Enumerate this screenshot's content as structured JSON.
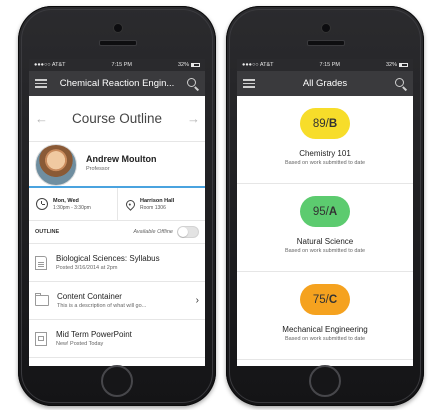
{
  "left_phone": {
    "status": {
      "carrier": "●●●○○ AT&T",
      "time": "7:15 PM",
      "battery": "32%"
    },
    "nav_title": "Chemical Reaction Engin...",
    "outline_title": "Course Outline",
    "prev_arrow": "←",
    "next_arrow": "→",
    "professor": {
      "name": "Andrew Moulton",
      "role": "Professor"
    },
    "schedule": {
      "days": "Mon, Wed",
      "time": "1:30pm - 3:30pm"
    },
    "location": {
      "building": "Harrison Hall",
      "room": "Room 1306"
    },
    "outline_label": "OUTLINE",
    "offline": {
      "label": "Available Offline",
      "enabled": false
    },
    "items": [
      {
        "icon": "pdf-document-icon",
        "title": "Biological Sciences: Syllabus",
        "subtitle": "Posted 3/16/2014 at 2pm"
      },
      {
        "icon": "folder-icon",
        "title": "Content Container",
        "subtitle": "This is a description of what will go...",
        "chevron": "›"
      },
      {
        "icon": "powerpoint-icon",
        "title": "Mid Term PowerPoint",
        "subtitle": "New! Posted Today"
      }
    ]
  },
  "right_phone": {
    "status": {
      "carrier": "●●●○○ AT&T",
      "time": "7:15 PM",
      "battery": "32%"
    },
    "nav_title": "All Grades",
    "grades": [
      {
        "score": "89/",
        "letter": "B",
        "color": "#f7dd2a",
        "course": "Chemistry 101",
        "note": "Based on work submitted to date"
      },
      {
        "score": "95/",
        "letter": "A",
        "color": "#5ccb6f",
        "course": "Natural Science",
        "note": "Based on work submitted to date"
      },
      {
        "score": "75/",
        "letter": "C",
        "color": "#f5a21f",
        "course": "Mechanical Engineering",
        "note": "Based on work submitted to date"
      }
    ]
  }
}
